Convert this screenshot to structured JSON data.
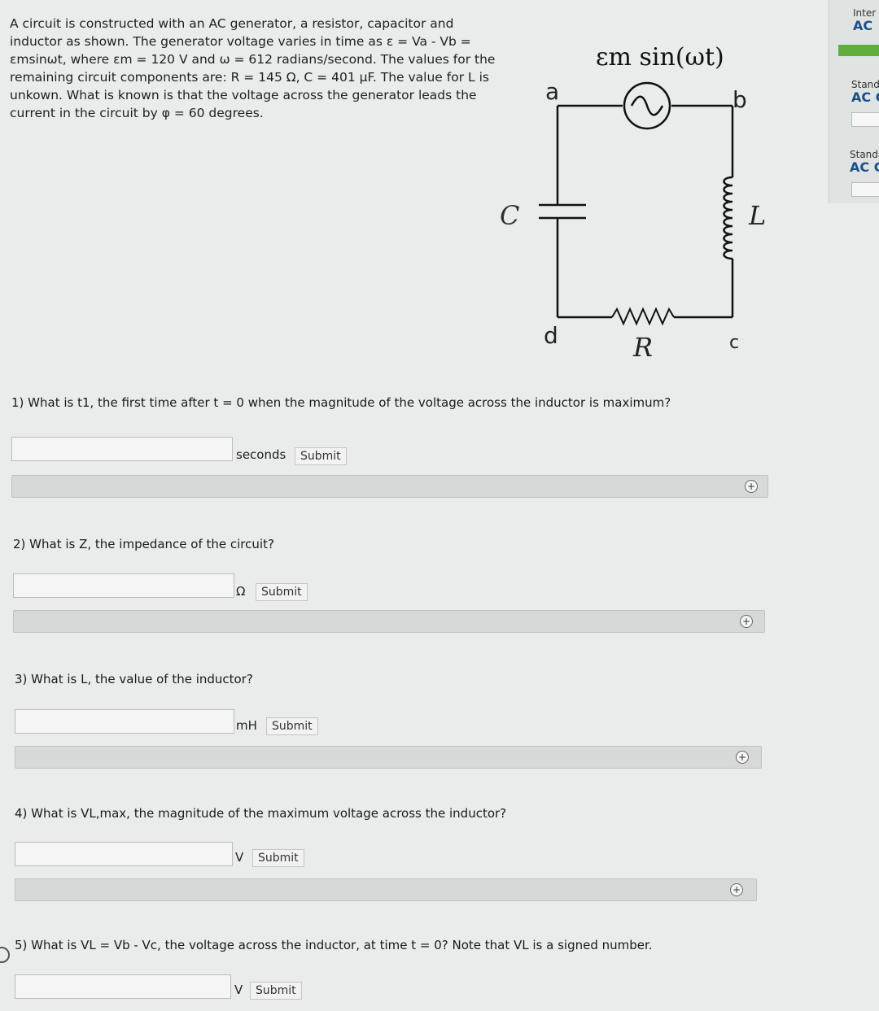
{
  "problem": {
    "line1": "A circuit is constructed with an AC generator, a resistor, capacitor and",
    "line2": "inductor as shown. The generator voltage varies in time as ε = Va - Vb =",
    "line3": "εmsinωt, where εm = 120 V and ω = 612 radians/second. The values for the",
    "line4": "remaining circuit components are: R = 145 Ω, C = 401 μF. The value for L is",
    "line5": "unkown. What is known is that the voltage across the generator leads the",
    "line6": "current in the circuit by φ = 60 degrees."
  },
  "circuit": {
    "emf_label": "εm sin(ωt)",
    "node_a": "a",
    "node_b": "b",
    "node_c": "c",
    "node_d": "d",
    "cap_label": "C",
    "ind_label": "L",
    "res_label": "R"
  },
  "sidebar": {
    "item1_line1": "Inter",
    "item1_line2": "AC",
    "item2_line1": "Stand",
    "item2_line2": "AC C",
    "item3_line1": "Standa",
    "item3_line2": "AC C"
  },
  "questions": [
    {
      "text": "1) What is t1, the first time after t = 0 when the magnitude of the voltage across the inductor is maximum?",
      "unit": "seconds",
      "submit": "Submit"
    },
    {
      "text": "2) What is Z, the impedance of the circuit?",
      "unit": "Ω",
      "submit": "Submit"
    },
    {
      "text": "3) What is L, the value of the inductor?",
      "unit": "mH",
      "submit": "Submit"
    },
    {
      "text": "4) What is VL,max, the magnitude of the maximum voltage across the inductor?",
      "unit": "V",
      "submit": "Submit"
    },
    {
      "text": "5) What is VL = Vb - Vc, the voltage across the inductor, at time t = 0? Note that VL is a signed number.",
      "unit": "V",
      "submit": "Submit"
    }
  ],
  "icons": {
    "expand": "plus-circle-icon",
    "plus_glyph": "+"
  }
}
